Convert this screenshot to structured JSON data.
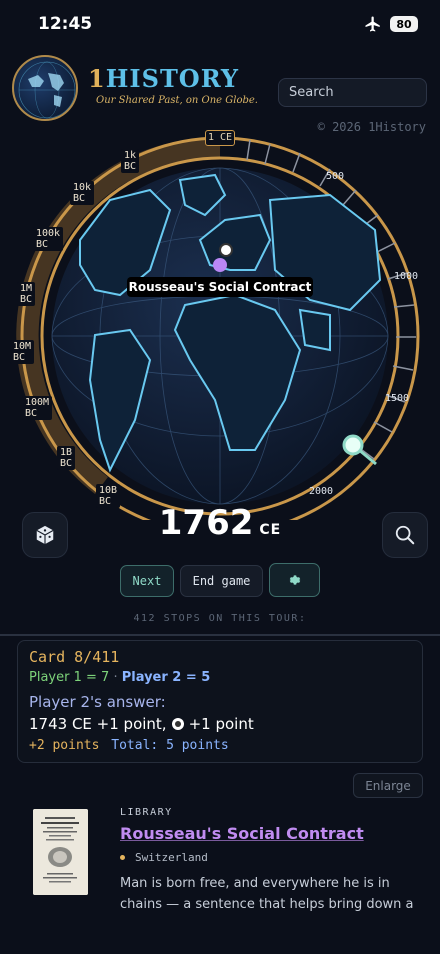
{
  "status_bar": {
    "time": "12:45",
    "battery": "80",
    "airplane_icon": "airplane-icon"
  },
  "header": {
    "logo_title_prefix": "1",
    "logo_title_main": "HISTORY",
    "tagline": "Our Shared Past, on One Globe.",
    "search_placeholder": "Search",
    "copyright": "© 2026 1History"
  },
  "dial": {
    "left_labels": [
      "1k BC",
      "10k BC",
      "100k BC",
      "1M BC",
      "10M BC",
      "100M BC",
      "1B BC",
      "10B BC"
    ],
    "top_label": "1 CE",
    "right_labels": [
      "500",
      "1000",
      "1500",
      "2000"
    ],
    "current_position_year": 1762
  },
  "globe": {
    "place_label": "Rousseau's Social Contract"
  },
  "year_readout": {
    "value": "1762",
    "era": "CE"
  },
  "controls": {
    "next_label": "Next",
    "end_label": "End game",
    "dice_icon": "dice-icon",
    "search_icon": "search-icon",
    "gear_icon": "gear-icon"
  },
  "tour": {
    "stops_text": "412 STOPS ON THIS TOUR:"
  },
  "card": {
    "number": "Card 8/411",
    "player1": "Player 1 = 7",
    "separator": "·",
    "player2": "Player 2 = 5",
    "answer_title": "Player 2's answer:",
    "answer_year": "1743 CE +1 point,",
    "answer_place": "+1 point",
    "points": "+2 points",
    "total": "Total: 5 points"
  },
  "enlarge_label": "Enlarge",
  "library": {
    "kicker": "LIBRARY",
    "title": "Rousseau's Social Contract",
    "place": "Switzerland",
    "description": "Man is born free, and everywhere he is in chains — a sentence that helps bring down a",
    "thumbnail_icon": "book-cover-icon"
  },
  "colors": {
    "accent_gold": "#e5b45e",
    "accent_teal": "#8fd9c7",
    "accent_purple": "#c08cf0",
    "accent_blue": "#8ab4ff",
    "globe_line": "#5ec0e8"
  }
}
